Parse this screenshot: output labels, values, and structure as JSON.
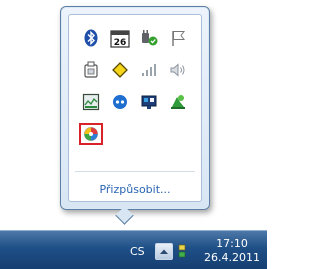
{
  "tray_popup": {
    "customize_label": "Přizpůsobit...",
    "rows": [
      [
        {
          "name": "bluetooth-icon"
        },
        {
          "name": "calendar-icon",
          "text": "26"
        },
        {
          "name": "plug-icon"
        },
        {
          "name": "flag-icon"
        }
      ],
      [
        {
          "name": "usb-device-icon"
        },
        {
          "name": "diamond-icon"
        },
        {
          "name": "signal-bars-icon"
        },
        {
          "name": "speaker-icon"
        }
      ],
      [
        {
          "name": "monitor-app-icon"
        },
        {
          "name": "blue-circle-app-icon"
        },
        {
          "name": "display-app-icon"
        },
        {
          "name": "green-recycle-icon"
        }
      ],
      [
        {
          "name": "colorful-app-icon",
          "selected": true
        }
      ]
    ]
  },
  "taskbar": {
    "language": "CS",
    "time": "17:10",
    "date": "26.4.2011"
  }
}
